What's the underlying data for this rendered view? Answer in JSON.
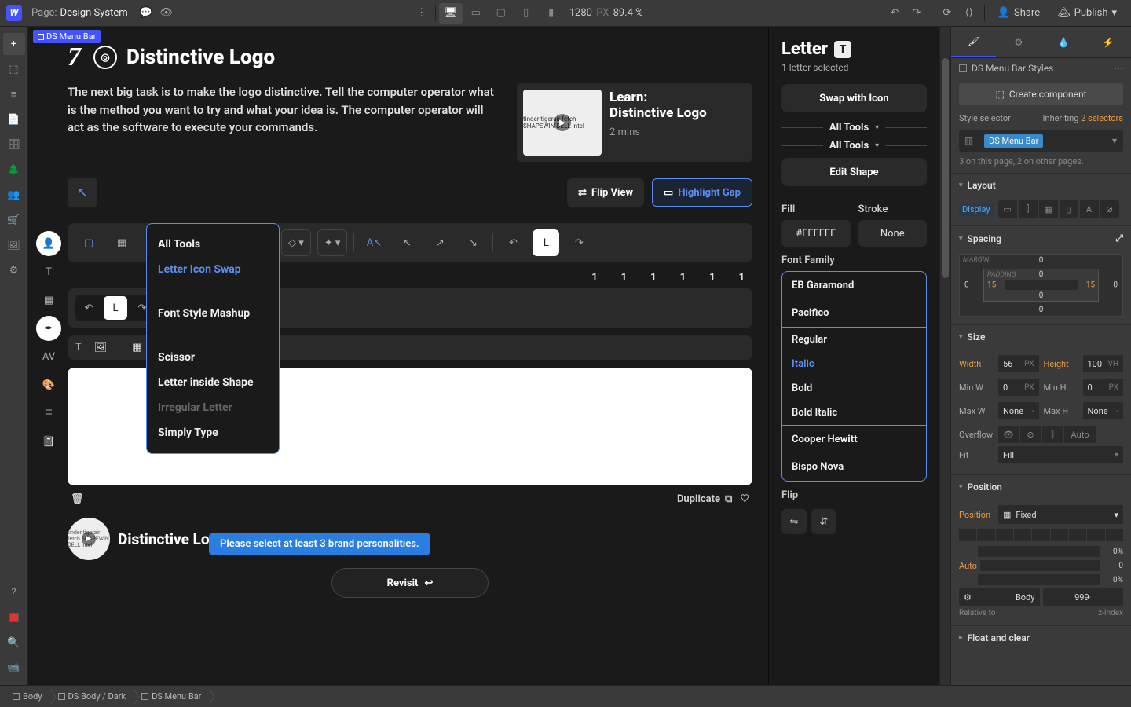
{
  "topbar": {
    "page_prefix": "Page:",
    "page_name": "Design System",
    "viewport_width": "1280",
    "viewport_unit": "PX",
    "zoom": "89.4 %",
    "share": "Share",
    "publish": "Publish"
  },
  "selection_tag": "DS Menu Bar",
  "canvas": {
    "step_num": "7",
    "heading": "Distinctive Logo",
    "intro": "The next big task is to make the logo distinctive. Tell the computer operator what is the method you want to try and what your idea is. The computer operator will act as the software to execute your commands.",
    "learn_title": "Learn:",
    "learn_sub": "Distinctive Logo",
    "learn_mins": "2 mins",
    "thumb_brands": "tinder tigerair fetch SHAPEWIN DELL intel",
    "flip_view": "Flip View",
    "highlight_gap": "Highlight Gap",
    "dropdown": {
      "all_tools": "All Tools",
      "items": [
        {
          "label": "Letter Icon Swap",
          "sel": true
        },
        {
          "label": "Font Style Mashup",
          "sel": false
        },
        {
          "label": "Scissor",
          "sel": false
        },
        {
          "label": "Letter inside Shape",
          "sel": false
        },
        {
          "label": "Irregular Letter",
          "sel": false,
          "dim": true
        },
        {
          "label": "Simply Type",
          "sel": false
        }
      ]
    },
    "num_row": [
      "1",
      "1",
      "1",
      "1",
      "1",
      "1"
    ],
    "dup": "Duplicate",
    "revisit_title": "Distinctive Logo",
    "banner": "Please select at least 3 brand personalities.",
    "revisit_btn": "Revisit"
  },
  "mid": {
    "title": "Letter",
    "letter": "T",
    "selected": "1 letter selected",
    "swap": "Swap with Icon",
    "all_tools": "All Tools",
    "edit_shape": "Edit Shape",
    "fill_lbl": "Fill",
    "stroke_lbl": "Stroke",
    "fill_val": "#FFFFFF",
    "stroke_val": "None",
    "font_family_lbl": "Font Family",
    "fonts_top": [
      "EB Garamond",
      "Pacifico"
    ],
    "font_weights": [
      {
        "label": "Regular",
        "sel": false
      },
      {
        "label": "Italic",
        "sel": true
      },
      {
        "label": "Bold",
        "sel": false
      },
      {
        "label": "Bold Italic",
        "sel": false
      }
    ],
    "fonts_bot": [
      "Cooper Hewitt",
      "Bispo Nova"
    ],
    "flip_lbl": "Flip"
  },
  "right": {
    "styles_name": "DS Menu Bar Styles",
    "create_comp": "Create component",
    "style_selector_lbl": "Style selector",
    "inheriting": "Inheriting",
    "inheriting_n": "2 selectors",
    "selector_chip": "DS Menu Bar",
    "selector_note": "3 on this page, 2 on other pages.",
    "layout": "Layout",
    "display_lbl": "Display",
    "spacing": "Spacing",
    "margin_lbl": "MARGIN",
    "padding_lbl": "PADDING",
    "spacing_vals": {
      "mt": "0",
      "mr": "0",
      "mb": "0",
      "ml": "0",
      "pt": "0",
      "pr": "15",
      "pb": "0",
      "pl": "15"
    },
    "size": "Size",
    "width_lbl": "Width",
    "width_v": "56",
    "width_u": "PX",
    "height_lbl": "Height",
    "height_v": "100",
    "height_u": "VH",
    "minw_lbl": "Min W",
    "minw_v": "0",
    "minw_u": "PX",
    "minh_lbl": "Min H",
    "minh_v": "0",
    "minh_u": "PX",
    "maxw_lbl": "Max W",
    "maxw_v": "None",
    "maxw_u": "-",
    "maxh_lbl": "Max H",
    "maxh_v": "None",
    "maxh_u": "-",
    "overflow_lbl": "Overflow",
    "overflow_auto": "Auto",
    "fit_lbl": "Fit",
    "fit_v": "Fill",
    "position": "Position",
    "position_lbl": "Position",
    "position_v": "Fixed",
    "auto_lbl": "Auto",
    "pct": "0%",
    "zero": "0",
    "rel_body": "Body",
    "rel_z": "999",
    "rel_to": "Relative to",
    "zindex": "z-Index",
    "float": "Float and clear"
  },
  "breadcrumb": [
    "Body",
    "DS Body / Dark",
    "DS Menu Bar"
  ]
}
